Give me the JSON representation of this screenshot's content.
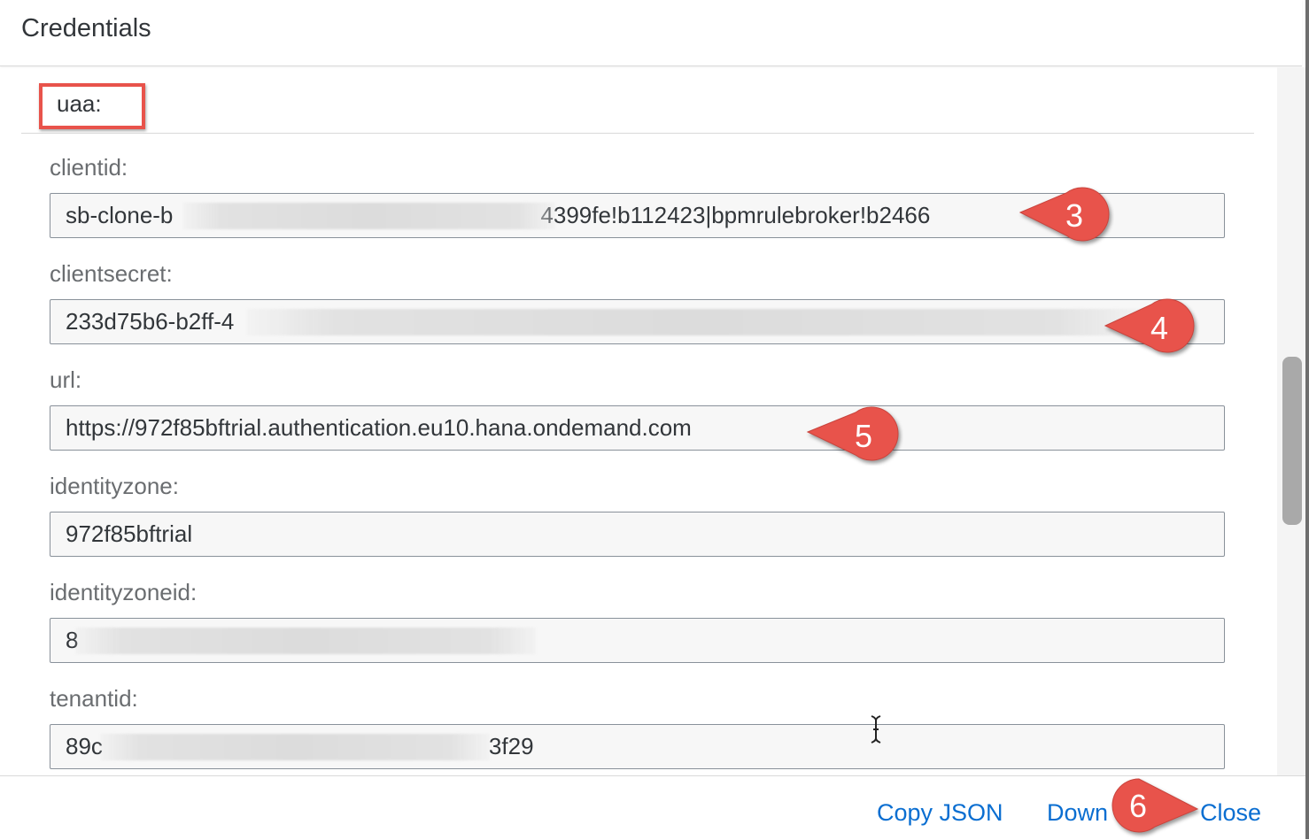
{
  "dialog": {
    "title": "Credentials"
  },
  "section": {
    "label": "uaa:"
  },
  "fields": [
    {
      "label": "clientid:",
      "value_start": "sb-clone-b",
      "value_end": "4399fe!b112423|bpmrulebroker!b2466"
    },
    {
      "label": "clientsecret:",
      "value_start": "233d75b6-b2ff-4",
      "value_end": ""
    },
    {
      "label": "url:",
      "value_start": "https://972f85bftrial.authentication.eu10.hana.ondemand.com",
      "value_end": ""
    },
    {
      "label": "identityzone:",
      "value_start": "972f85bftrial",
      "value_end": ""
    },
    {
      "label": "identityzoneid:",
      "value_start": "8",
      "value_end": ""
    },
    {
      "label": "tenantid:",
      "value_start": "89c",
      "value_end": "3f29"
    }
  ],
  "footer": {
    "copy_json_label": "Copy JSON",
    "download_label": "Down",
    "close_label": "Close"
  },
  "callouts": {
    "c3": "3",
    "c4": "4",
    "c5": "5",
    "c6": "6"
  },
  "colors": {
    "callout": "#e8534b",
    "link": "#0a6ed1",
    "highlight": "#e8534b"
  }
}
